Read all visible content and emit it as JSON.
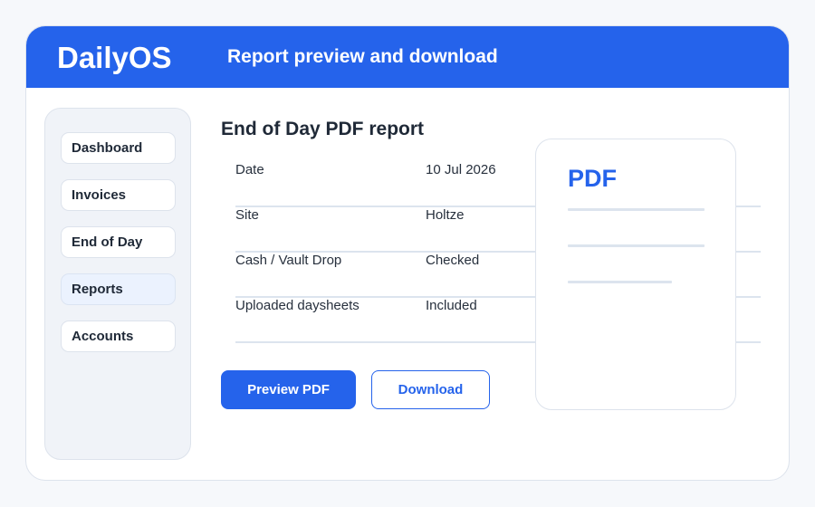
{
  "header": {
    "brand": "DailyOS",
    "title": "Report preview and download"
  },
  "sidebar": {
    "items": [
      {
        "label": "Dashboard",
        "active": false
      },
      {
        "label": "Invoices",
        "active": false
      },
      {
        "label": "End of Day",
        "active": false
      },
      {
        "label": "Reports",
        "active": true
      },
      {
        "label": "Accounts",
        "active": false
      }
    ]
  },
  "main": {
    "title": "End of Day PDF report",
    "rows": [
      {
        "key": "Date",
        "value": "10 Jul 2026"
      },
      {
        "key": "Site",
        "value": "Holtze"
      },
      {
        "key": "Cash / Vault Drop",
        "value": "Checked"
      },
      {
        "key": "Uploaded daysheets",
        "value": "Included"
      }
    ],
    "buttons": {
      "preview": "Preview PDF",
      "download": "Download"
    }
  },
  "pdf_preview": {
    "label": "PDF",
    "icon": "pdf-document-icon"
  },
  "colors": {
    "accent": "#2563eb",
    "background": "#f6f8fb",
    "border": "#dde3ec",
    "text": "#1f2937"
  }
}
